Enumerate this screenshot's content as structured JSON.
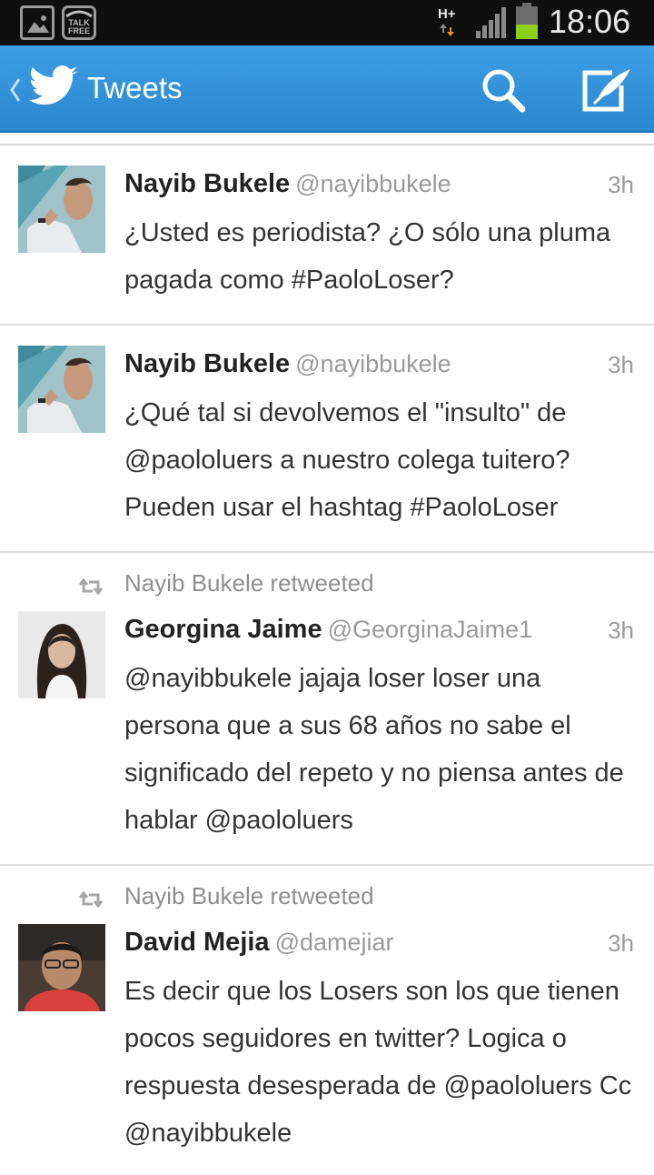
{
  "status_bar": {
    "icons": [
      "gallery-icon",
      "talkfree-icon",
      "signal-icon",
      "battery-icon"
    ],
    "talkfree_label": "TALK FREE",
    "network": "H+",
    "time": "18:06",
    "battery_color": "#8ccf16"
  },
  "action_bar": {
    "title": "Tweets",
    "background": "#2f90d8",
    "icons": [
      "back-chevron-icon",
      "twitter-bird-icon",
      "search-icon",
      "compose-icon"
    ]
  },
  "timeline": [
    {
      "retweeted_by": "",
      "name": "Nayib Bukele",
      "handle": "@nayibbukele",
      "time": "3h",
      "text": "¿Usted es periodista? ¿O sólo una pluma pagada como #PaoloLoser?"
    },
    {
      "retweeted_by": "",
      "name": "Nayib Bukele",
      "handle": "@nayibbukele",
      "time": "3h",
      "text": "¿Qué tal si devolvemos el \"insulto\" de @paololuers a nuestro colega tuitero? Pueden usar el hashtag #PaoloLoser"
    },
    {
      "retweeted_by": "Nayib Bukele retweeted",
      "name": "Georgina Jaime",
      "handle": "@GeorginaJaime1",
      "time": "3h",
      "text": "@nayibbukele jajaja loser loser una persona que a sus 68 años no sabe el significado del repeto y no piensa antes de hablar @paololuers"
    },
    {
      "retweeted_by": "Nayib Bukele retweeted",
      "name": "David Mejia",
      "handle": "@damejiar",
      "time": "3h",
      "text": "Es decir que los Losers son los que tienen pocos seguidores en twitter? Logica o respuesta desesperada de @paololuers Cc @nayibbukele"
    }
  ]
}
